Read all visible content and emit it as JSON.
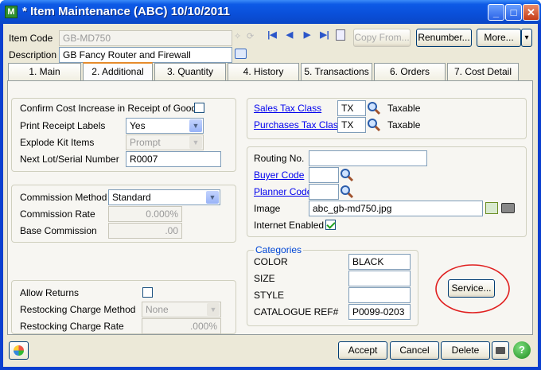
{
  "window": {
    "icon": "M",
    "title": "* Item Maintenance (ABC) 10/10/2011",
    "min": "_",
    "max": "□",
    "close": "✕"
  },
  "header": {
    "item_code_label": "Item Code",
    "item_code_value": "GB-MD750",
    "description_label": "Description",
    "description_value": "GB Fancy Router and Firewall",
    "copy_from": "Copy From...",
    "renumber": "Renumber...",
    "more": "More...",
    "more_arrow": "▾"
  },
  "tabs": [
    "1. Main",
    "2. Additional",
    "3. Quantity",
    "4. History",
    "5. Transactions",
    "6. Orders",
    "7. Cost Detail"
  ],
  "receipt": {
    "confirm_label": "Confirm Cost Increase in Receipt of Goods",
    "print_label": "Print Receipt Labels",
    "print_value": "Yes",
    "explode_label": "Explode Kit Items",
    "explode_value": "Prompt",
    "lot_label": "Next Lot/Serial Number",
    "lot_value": "R0007"
  },
  "commission": {
    "method_label": "Commission Method",
    "method_value": "Standard",
    "rate_label": "Commission Rate",
    "rate_value": "0.000%",
    "base_label": "Base Commission",
    "base_value": ".00"
  },
  "returns": {
    "allow_label": "Allow Returns",
    "method_label": "Restocking Charge Method",
    "method_value": "None",
    "rate_label": "Restocking Charge Rate",
    "rate_value": ".000%"
  },
  "tax": {
    "sales_label": "Sales Tax Class",
    "sales_value": "TX",
    "sales_desc": "Taxable",
    "purch_label": "Purchases Tax Class",
    "purch_value": "TX",
    "purch_desc": "Taxable"
  },
  "routing": {
    "routing_label": "Routing No.",
    "routing_value": "",
    "buyer_label": "Buyer Code",
    "buyer_value": "",
    "planner_label": "Planner Code",
    "planner_value": "",
    "image_label": "Image",
    "image_value": "abc_gb-md750.jpg",
    "internet_label": "Internet Enabled"
  },
  "categories": {
    "title": "Categories",
    "rows": [
      {
        "label": "COLOR",
        "value": "BLACK"
      },
      {
        "label": "SIZE",
        "value": ""
      },
      {
        "label": "STYLE",
        "value": ""
      },
      {
        "label": "CATALOGUE REF#",
        "value": "P0099-0203"
      }
    ]
  },
  "service_button": "Service...",
  "footer": {
    "accept": "Accept",
    "cancel": "Cancel",
    "delete": "Delete",
    "help": "?"
  },
  "highlight_color": "#e02020"
}
